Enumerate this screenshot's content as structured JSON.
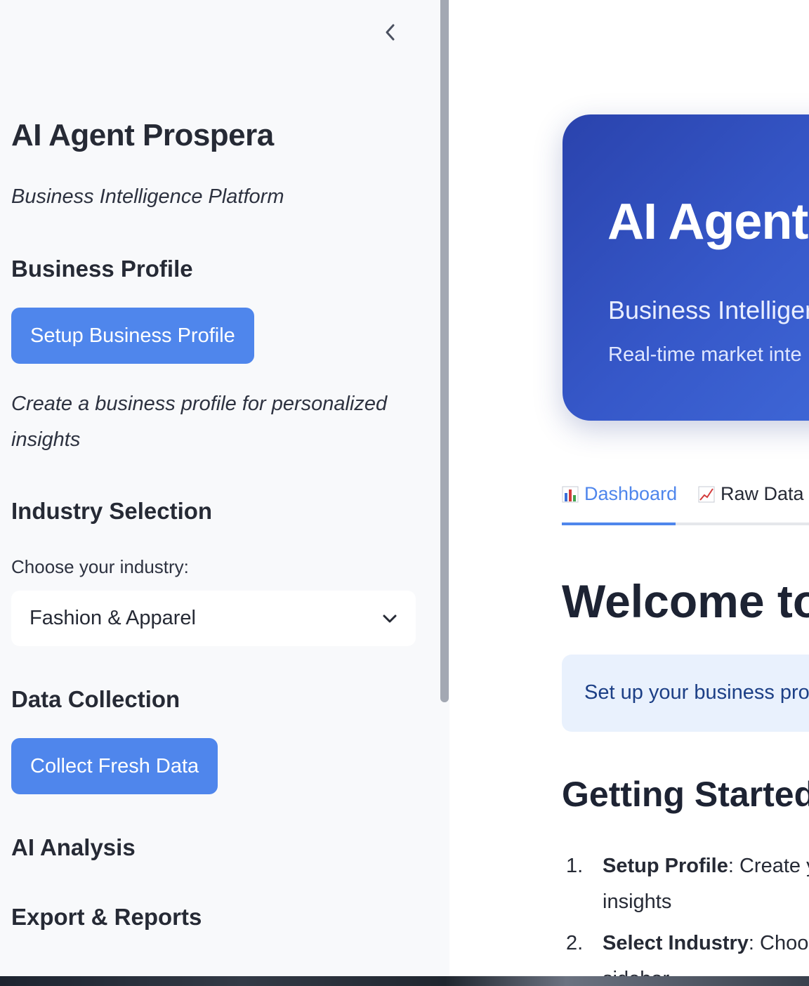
{
  "sidebar": {
    "title": "AI Agent Prospera",
    "subtitle": "Business Intelligence Platform",
    "sections": {
      "business_profile": {
        "heading": "Business Profile",
        "button_label": "Setup Business Profile",
        "note": "Create a business profile for personalized insights"
      },
      "industry_selection": {
        "heading": "Industry Selection",
        "label": "Choose your industry:",
        "selected": "Fashion & Apparel"
      },
      "data_collection": {
        "heading": "Data Collection",
        "button_label": "Collect Fresh Data"
      },
      "ai_analysis": {
        "heading": "AI Analysis"
      },
      "export_reports": {
        "heading": "Export & Reports"
      }
    }
  },
  "main": {
    "hero": {
      "title": "AI Agent",
      "subtitle": "Business Intelliger",
      "tagline": "Real-time market inte"
    },
    "tabs": [
      {
        "icon": "bar-chart-icon",
        "label": "Dashboard",
        "active": true
      },
      {
        "icon": "line-chart-icon",
        "label": "Raw Data",
        "active": false
      }
    ],
    "welcome_heading": "Welcome to",
    "info_text": "Set up your business pro",
    "getting_started": {
      "heading": "Getting Started",
      "steps": [
        {
          "num": "1.",
          "bold": "Setup Profile",
          "text": ": Create y",
          "continuation": "insights"
        },
        {
          "num": "2.",
          "bold": "Select Industry",
          "text": ": Choos",
          "continuation": "sidebar"
        }
      ]
    }
  },
  "colors": {
    "accent": "#4f86ec",
    "hero_gradient_start": "#2a43ad",
    "hero_gradient_end": "#436fde",
    "info_bg": "#e9f1fd",
    "sidebar_bg": "#f8f9fb"
  }
}
